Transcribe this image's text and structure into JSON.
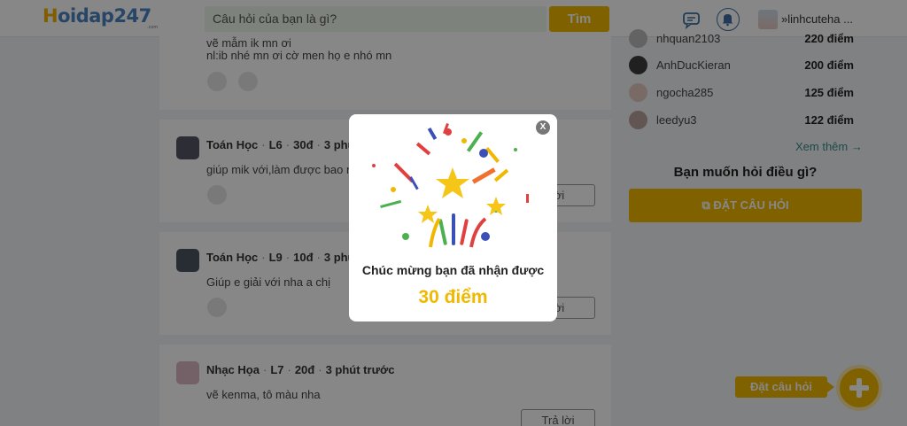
{
  "header": {
    "logo_h": "H",
    "logo_rest": "oidap247",
    "logo_com": ".com",
    "search_placeholder": "Câu hỏi của bạn là gì?",
    "search_button": "Tìm",
    "user_name": "linhcuteha ...",
    "user_caret": "»"
  },
  "feed": [
    {
      "subject": "",
      "grade": "",
      "points": "",
      "time": "",
      "lines": [
        "vẽ mẫm ik mn ơi",
        "nl:ib nhé mn ơi cờ men họ e nhó mn"
      ],
      "reply_label": ""
    },
    {
      "subject": "Toán Học",
      "grade": "L6",
      "points": "30đ",
      "time": "3 phút",
      "lines": [
        "giúp mik với,làm được bao nh"
      ],
      "reply_label": "lời"
    },
    {
      "subject": "Toán Học",
      "grade": "L9",
      "points": "10đ",
      "time": "3 phút",
      "lines": [
        "Giúp e giải với nha a chị"
      ],
      "reply_label": "lời"
    },
    {
      "subject": "Nhạc Họa",
      "grade": "L7",
      "points": "20đ",
      "time": "3 phút trước",
      "lines": [
        "vẽ kenma, tô màu nha"
      ],
      "reply_label": "Trả lời"
    }
  ],
  "ranking": [
    {
      "name": "nhquan2103",
      "points": "220 điểm"
    },
    {
      "name": "AnhDucKieran",
      "points": "200 điểm"
    },
    {
      "name": "ngocha285",
      "points": "125 điểm"
    },
    {
      "name": "leedyu3",
      "points": "122 điểm"
    }
  ],
  "sidebar": {
    "see_more": "Xem thêm →",
    "ask_title": "Bạn muốn hỏi điều gì?",
    "ask_button": "ĐẶT CÂU HỎI"
  },
  "floating": {
    "tag": "Đặt câu hỏi"
  },
  "modal": {
    "close": "X",
    "message": "Chúc mừng bạn đã nhận được",
    "points": "30 điểm"
  },
  "colors": {
    "accent": "#f0b800",
    "brand_blue": "#4a83c3",
    "overlay": "rgba(0,0,0,0.47)"
  }
}
